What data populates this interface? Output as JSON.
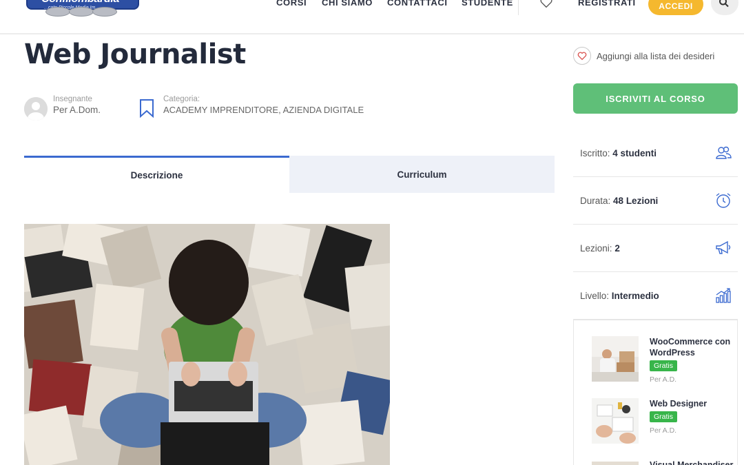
{
  "header": {
    "logo_text": "Confilombardia",
    "logo_sub": "...cato Piccole Medie Im...",
    "nav": [
      "CORSI",
      "CHI SIAMO",
      "CONTATTACI",
      "STUDENTE"
    ],
    "registrati": "REGISTRATI",
    "accedi": "ACCEDI"
  },
  "course": {
    "title": "Web Journalist",
    "teacher_label": "Insegnante",
    "teacher_value": "Per A.Dom.",
    "category_label": "Categoria:",
    "category_value": "ACADEMY IMPRENDITORE, AZIENDA DIGITALE"
  },
  "tabs": [
    {
      "label": "Descrizione",
      "active": true
    },
    {
      "label": "Curriculum",
      "active": false
    }
  ],
  "sidebar": {
    "wishlist": "Aggiungi alla lista dei desideri",
    "enroll": "ISCRIVITI AL CORSO",
    "info": [
      {
        "label": "Iscritto:",
        "value": "4 studenti",
        "icon": "students-icon"
      },
      {
        "label": "Durata:",
        "value": "48 Lezioni",
        "icon": "alarm-clock-icon"
      },
      {
        "label": "Lezioni:",
        "value": "2",
        "icon": "megaphone-icon"
      },
      {
        "label": "Livello:",
        "value": "Intermedio",
        "icon": "bar-chart-icon"
      }
    ],
    "related": [
      {
        "title": "WooCommerce con WordPress",
        "badge": "Gratis",
        "by": "Per A.D."
      },
      {
        "title": "Web Designer",
        "badge": "Gratis",
        "by": "Per A.D."
      },
      {
        "title": "Visual Merchandiser",
        "badge": "",
        "by": ""
      }
    ]
  },
  "colors": {
    "accent": "#3b6ad0",
    "enroll": "#5fbf78",
    "accedi": "#f5b82e",
    "badge": "#38b54a",
    "title": "#232a3b"
  }
}
